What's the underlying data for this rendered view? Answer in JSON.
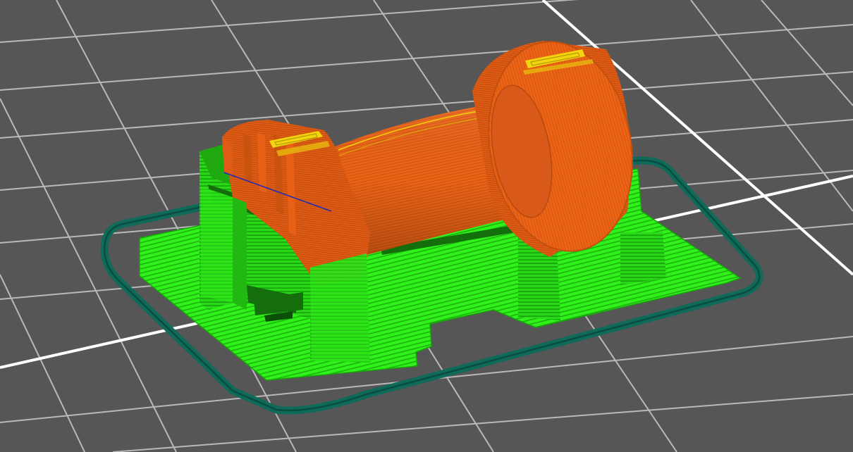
{
  "viewport": {
    "kind": "3D slicer layer preview",
    "view": "perspective"
  },
  "colors": {
    "bed": "#565656",
    "grid_minor": "#b9b9b9",
    "grid_major": "#ffffff",
    "skirt": "#0f6a5a",
    "support": "#2ff21a",
    "support_shade": "#22b812",
    "support_dark": "#136e0b",
    "perimeter": "#ec6316",
    "perimeter_shade": "#c8500f",
    "top_solid": "#f1d50d",
    "bridge": "#1c2cb8"
  },
  "extrusion_roles": [
    {
      "role": "skirt",
      "color": "#0f6a5a"
    },
    {
      "role": "support_material",
      "color": "#2ff21a"
    },
    {
      "role": "perimeter",
      "color": "#ec6316"
    },
    {
      "role": "top_solid_infill",
      "color": "#f1d50d"
    },
    {
      "role": "bridge_infill",
      "color": "#1c2cb8"
    }
  ],
  "model": {
    "shape": "spool",
    "parts": [
      "left-flange",
      "drum",
      "right-flange",
      "support-base",
      "support-towers"
    ]
  }
}
